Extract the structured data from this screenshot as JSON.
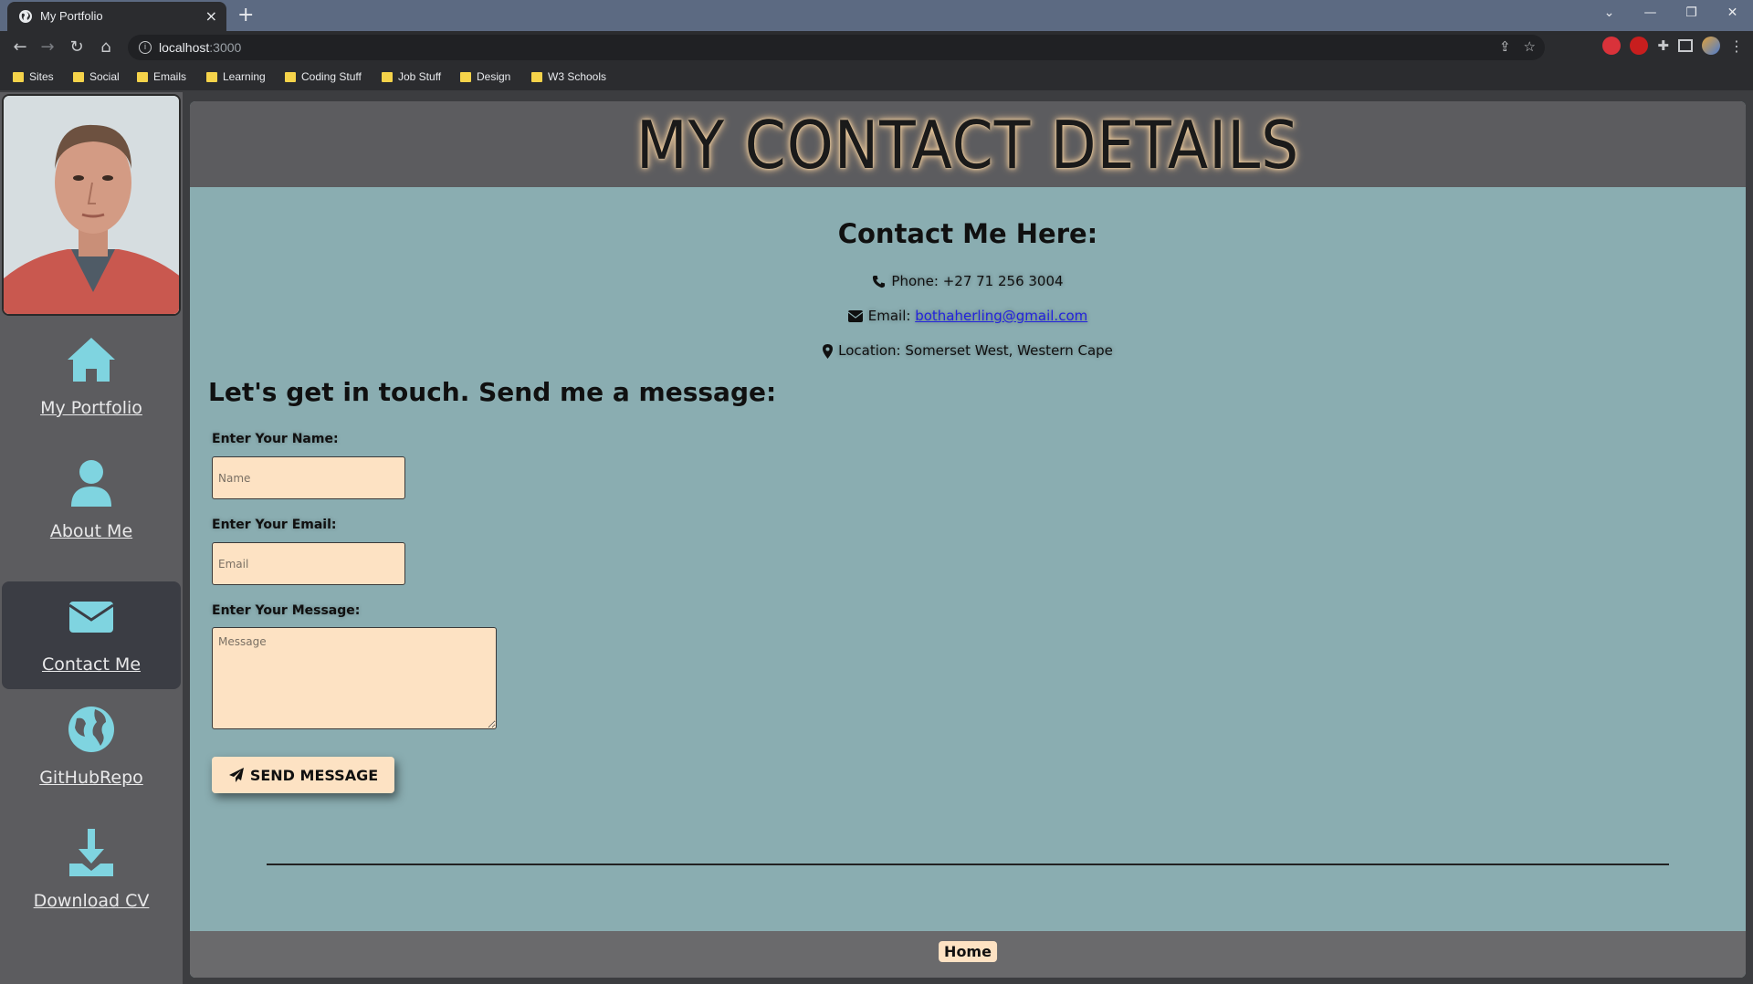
{
  "browser": {
    "tab_title": "My Portfolio",
    "tab_close": "×",
    "new_tab": "+",
    "url_host": "localhost",
    "url_port": ":3000",
    "bookmarks": [
      "Sites",
      "Social",
      "Emails",
      "Learning",
      "Coding Stuff",
      "Job Stuff",
      "Design",
      "W3 Schools"
    ]
  },
  "sidebar": {
    "items": [
      {
        "label": "My Portfolio",
        "icon": "home-icon"
      },
      {
        "label": "About Me",
        "icon": "user-icon"
      },
      {
        "label": "Contact Me",
        "icon": "envelope-icon",
        "active": true
      },
      {
        "label": "GitHubRepo",
        "icon": "globe-icon"
      },
      {
        "label": "Download CV",
        "icon": "download-icon"
      }
    ]
  },
  "main": {
    "title": "MY CONTACT DETAILS",
    "contact_heading": "Contact Me Here:",
    "phone": "Phone: +27 71 256 3004",
    "email_label": "Email:",
    "email_link": "bothaherling@gmail.com",
    "location": "Location: Somerset West, Western Cape",
    "form_heading": "Let's get in touch. Send me a message:",
    "name_label": "Enter Your Name:",
    "name_placeholder": "Name",
    "email_field_label": "Enter Your Email:",
    "email_placeholder": "Email",
    "message_label": "Enter Your Message:",
    "message_placeholder": "Message",
    "send_label": "SEND MESSAGE",
    "footer_home": "Home"
  },
  "colors": {
    "content_bg": "#8aadb1",
    "band_bg": "#5c5c5f",
    "input_bg": "#fde2c3",
    "icon_color": "#7fd4e0"
  }
}
